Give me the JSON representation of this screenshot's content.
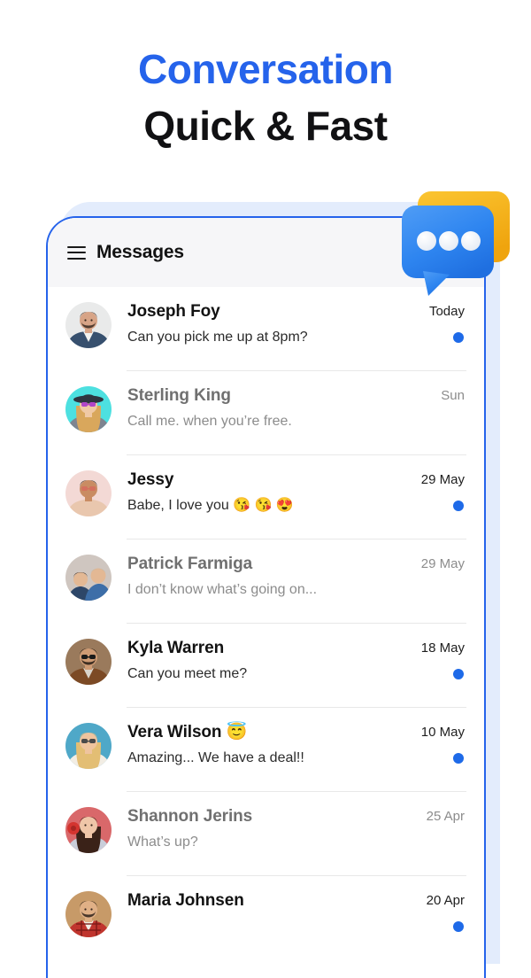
{
  "headline": {
    "line1": "Conversation",
    "line2": "Quick & Fast"
  },
  "colors": {
    "accent_blue": "#2563EB",
    "dot_blue": "#1E6AE8",
    "badge_yellow": "#F5B820",
    "heading_dark": "#111113",
    "phone_shadow": "#E3ECFC",
    "header_bg": "#F6F6F8",
    "divider": "#E8E8E8"
  },
  "phone": {
    "header": {
      "menu_icon": "hamburger-menu-icon",
      "title": "Messages"
    },
    "badge_icon": "chat-bubble-icon",
    "conversations": [
      {
        "name": "Joseph Foy",
        "preview": "Can you pick me up at 8pm?",
        "time": "Today",
        "unread": true,
        "avatar": "man-in-denim-jacket-on-gray"
      },
      {
        "name": "Sterling King",
        "preview": "Call me. when you’re free.",
        "time": "Sun",
        "unread": false,
        "avatar": "woman-with-hat-and-sunglasses-on-cyan"
      },
      {
        "name": "Jessy",
        "preview": "Babe, I love you 😘 😘 😍",
        "time": "29 May",
        "unread": true,
        "avatar": "man-with-sunglasses-on-pink"
      },
      {
        "name": "Patrick Farmiga",
        "preview": "I don’t know what’s going on...",
        "time": "29 May",
        "unread": false,
        "avatar": "couple-in-blue-outfits"
      },
      {
        "name": "Kyla Warren",
        "preview": "Can you meet me?",
        "time": "18 May",
        "unread": true,
        "avatar": "man-in-sunglasses-brown-jacket"
      },
      {
        "name": "Vera Wilson 😇",
        "preview": "Amazing... We have a deal!!",
        "time": "10 May",
        "unread": true,
        "avatar": "blonde-woman-at-beach"
      },
      {
        "name": "Shannon Jerins",
        "preview": "What’s up?",
        "time": "25 Apr",
        "unread": false,
        "avatar": "brunette-woman-with-red-flower"
      },
      {
        "name": "Maria Johnsen",
        "preview": "",
        "time": "20 Apr",
        "unread": true,
        "avatar": "man-in-red-plaid-shirt-on-tan"
      }
    ]
  }
}
